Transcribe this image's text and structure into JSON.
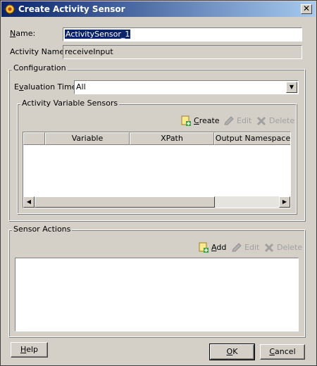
{
  "window": {
    "title": "Create Activity Sensor"
  },
  "form": {
    "name_label_prefix": "",
    "name_label_mnemonic": "N",
    "name_label_rest": "ame:",
    "name_value": "ActivitySensor_1",
    "activity_name_label": "Activity Name:",
    "activity_name_value": "receiveInput"
  },
  "configuration": {
    "title": "Configuration",
    "evaluation_time_label_prefix": "E",
    "evaluation_time_label_mnemonic": "v",
    "evaluation_time_label_rest": "aluation Time:",
    "evaluation_time_value": "All",
    "activity_variable_sensors": {
      "title": "Activity Variable Sensors",
      "create_label": "Create",
      "create_mnemonic": "C",
      "create_rest": "reate",
      "edit_label": "Edit",
      "delete_label": "Delete",
      "columns": [
        "",
        "Variable",
        "XPath",
        "Output Namespace"
      ]
    }
  },
  "sensor_actions": {
    "title": "Sensor Actions",
    "add_mnemonic": "A",
    "add_rest": "dd",
    "edit_label": "Edit",
    "delete_label": "Delete"
  },
  "buttons": {
    "help_mnemonic": "H",
    "help_rest": "elp",
    "ok_mnemonic": "O",
    "ok_rest": "K",
    "cancel_mnemonic": "C",
    "cancel_rest": "ancel"
  },
  "colors": {
    "title_start": "#0a246a",
    "title_end": "#a6caf0",
    "face": "#d4d0c8",
    "selection": "#0a246a"
  },
  "icons": {
    "app": "sensor-app-icon",
    "close": "close-icon",
    "create": "create-plus-icon",
    "edit": "edit-pencil-icon",
    "delete": "delete-x-icon"
  }
}
